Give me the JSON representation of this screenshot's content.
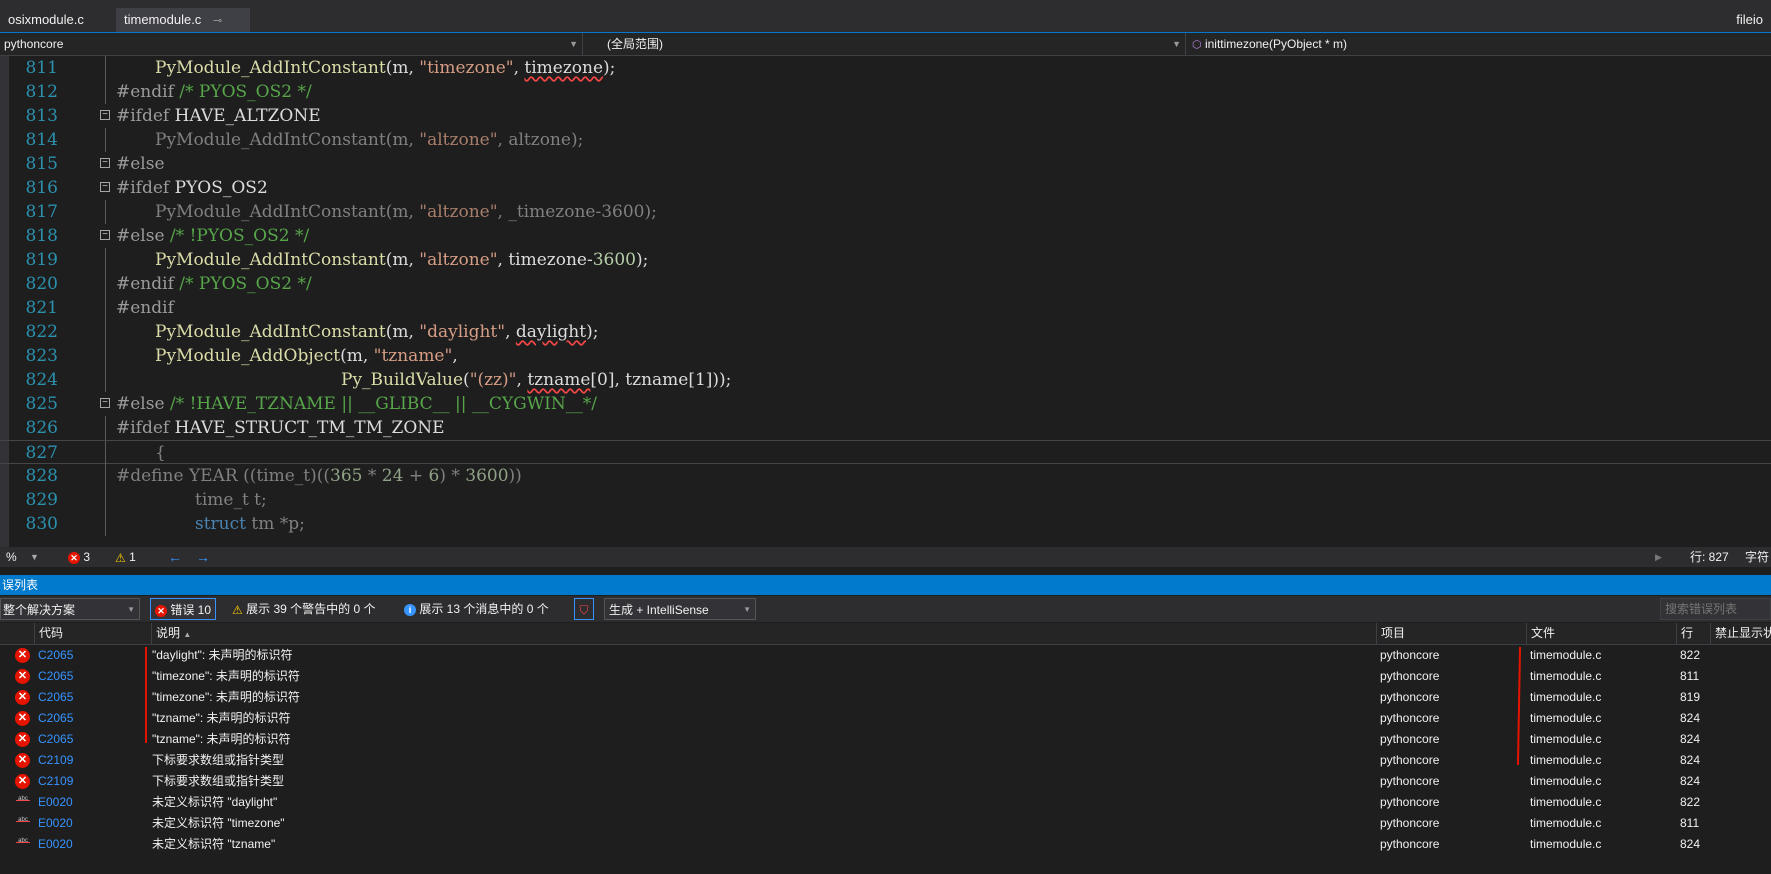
{
  "tabs": [
    {
      "label": "osixmodule.c"
    },
    {
      "label": "timemodule.c"
    }
  ],
  "tab_right_label": "fileio",
  "nav": {
    "project": "pythoncore",
    "scope": "(全局范围)",
    "function": "inittimezone(PyObject * m)"
  },
  "code_lines": [
    {
      "num": "811"
    },
    {
      "num": "812"
    },
    {
      "num": "813"
    },
    {
      "num": "814"
    },
    {
      "num": "815"
    },
    {
      "num": "816"
    },
    {
      "num": "817"
    },
    {
      "num": "818"
    },
    {
      "num": "819"
    },
    {
      "num": "820"
    },
    {
      "num": "821"
    },
    {
      "num": "822"
    },
    {
      "num": "823"
    },
    {
      "num": "824"
    },
    {
      "num": "825"
    },
    {
      "num": "826"
    },
    {
      "num": "827"
    },
    {
      "num": "828"
    },
    {
      "num": "829"
    },
    {
      "num": "830"
    }
  ],
  "code": {
    "l811": {
      "a": "PyModule_AddIntConstant",
      "b": "(m, ",
      "c": "\"timezone\"",
      "d": ", ",
      "e": "timezone",
      "f": ");"
    },
    "l812": {
      "a": "#endif ",
      "b": "/* PYOS_OS2 */"
    },
    "l813": {
      "a": "#ifdef ",
      "b": "HAVE_ALTZONE"
    },
    "l814": {
      "a": "PyModule_AddIntConstant(m, ",
      "b": "\"altzone\"",
      "c": ", altzone);"
    },
    "l815": {
      "a": "#else"
    },
    "l816": {
      "a": "#ifdef ",
      "b": "PYOS_OS2"
    },
    "l817": {
      "a": "PyModule_AddIntConstant(m, ",
      "b": "\"altzone\"",
      "c": ", _timezone-3600);"
    },
    "l818": {
      "a": "#else ",
      "b": "/* !PYOS_OS2 */"
    },
    "l819": {
      "a": "PyModule_AddIntConstant",
      "b": "(m, ",
      "c": "\"altzone\"",
      "d": ", timezone-",
      "e": "3600",
      "f": ");"
    },
    "l820": {
      "a": "#endif ",
      "b": "/* PYOS_OS2 */"
    },
    "l821": {
      "a": "#endif"
    },
    "l822": {
      "a": "PyModule_AddIntConstant",
      "b": "(m, ",
      "c": "\"daylight\"",
      "d": ", ",
      "e": "daylight",
      "f": ");"
    },
    "l823": {
      "a": "PyModule_AddObject",
      "b": "(m, ",
      "c": "\"tzname\"",
      "d": ","
    },
    "l824": {
      "a": "Py_BuildValue",
      "b": "(",
      "c": "\"(zz)\"",
      "d": ", ",
      "e": "tzname",
      "f": "[0], tzname[1]));"
    },
    "l825": {
      "a": "#else ",
      "b": "/* !HAVE_TZNAME || __GLIBC__ || __CYGWIN__*/"
    },
    "l826": {
      "a": "#ifdef ",
      "b": "HAVE_STRUCT_TM_TM_ZONE"
    },
    "l827": {
      "a": "{"
    },
    "l828": {
      "a": "#define ",
      "b": "YEAR ((time_t)((",
      "c": "365",
      "d": " * ",
      "e": "24",
      "f": " + ",
      "g": "6",
      "h": ") * ",
      "i": "3600",
      "j": "))"
    },
    "l829": {
      "a": "time_t t;"
    },
    "l830": {
      "a": "struct",
      "b": " tm *p;"
    }
  },
  "editor_status": {
    "zoom": "%",
    "errors": "3",
    "warnings": "1",
    "line": "行: 827",
    "char": "字符"
  },
  "error_list": {
    "title": "误列表",
    "scope_select": "整个解决方案",
    "errors_btn": "错误 10",
    "warnings_btn": "展示 39 个警告中的 0 个",
    "messages_btn": "展示 13 个消息中的 0 个",
    "build_select": "生成 + IntelliSense",
    "search_placeholder": "搜索错误列表",
    "columns": {
      "code": "代码",
      "desc": "说明",
      "project": "项目",
      "file": "文件",
      "line": "行",
      "suppress": "禁止显示状"
    },
    "rows": [
      {
        "type": "error",
        "code": "C2065",
        "desc": "\"daylight\": 未声明的标识符",
        "project": "pythoncore",
        "file": "timemodule.c",
        "line": "822"
      },
      {
        "type": "error",
        "code": "C2065",
        "desc": "\"timezone\": 未声明的标识符",
        "project": "pythoncore",
        "file": "timemodule.c",
        "line": "811"
      },
      {
        "type": "error",
        "code": "C2065",
        "desc": "\"timezone\": 未声明的标识符",
        "project": "pythoncore",
        "file": "timemodule.c",
        "line": "819"
      },
      {
        "type": "error",
        "code": "C2065",
        "desc": "\"tzname\": 未声明的标识符",
        "project": "pythoncore",
        "file": "timemodule.c",
        "line": "824"
      },
      {
        "type": "error",
        "code": "C2065",
        "desc": "\"tzname\": 未声明的标识符",
        "project": "pythoncore",
        "file": "timemodule.c",
        "line": "824"
      },
      {
        "type": "error",
        "code": "C2109",
        "desc": "下标要求数组或指针类型",
        "project": "pythoncore",
        "file": "timemodule.c",
        "line": "824"
      },
      {
        "type": "error",
        "code": "C2109",
        "desc": "下标要求数组或指针类型",
        "project": "pythoncore",
        "file": "timemodule.c",
        "line": "824"
      },
      {
        "type": "intellisense",
        "code": "E0020",
        "desc": "未定义标识符 \"daylight\"",
        "project": "pythoncore",
        "file": "timemodule.c",
        "line": "822"
      },
      {
        "type": "intellisense",
        "code": "E0020",
        "desc": "未定义标识符 \"timezone\"",
        "project": "pythoncore",
        "file": "timemodule.c",
        "line": "811"
      },
      {
        "type": "intellisense",
        "code": "E0020",
        "desc": "未定义标识符 \"tzname\"",
        "project": "pythoncore",
        "file": "timemodule.c",
        "line": "824"
      }
    ]
  },
  "colors": {
    "accent": "#007acc",
    "error": "#e51400",
    "link": "#3794ff"
  }
}
